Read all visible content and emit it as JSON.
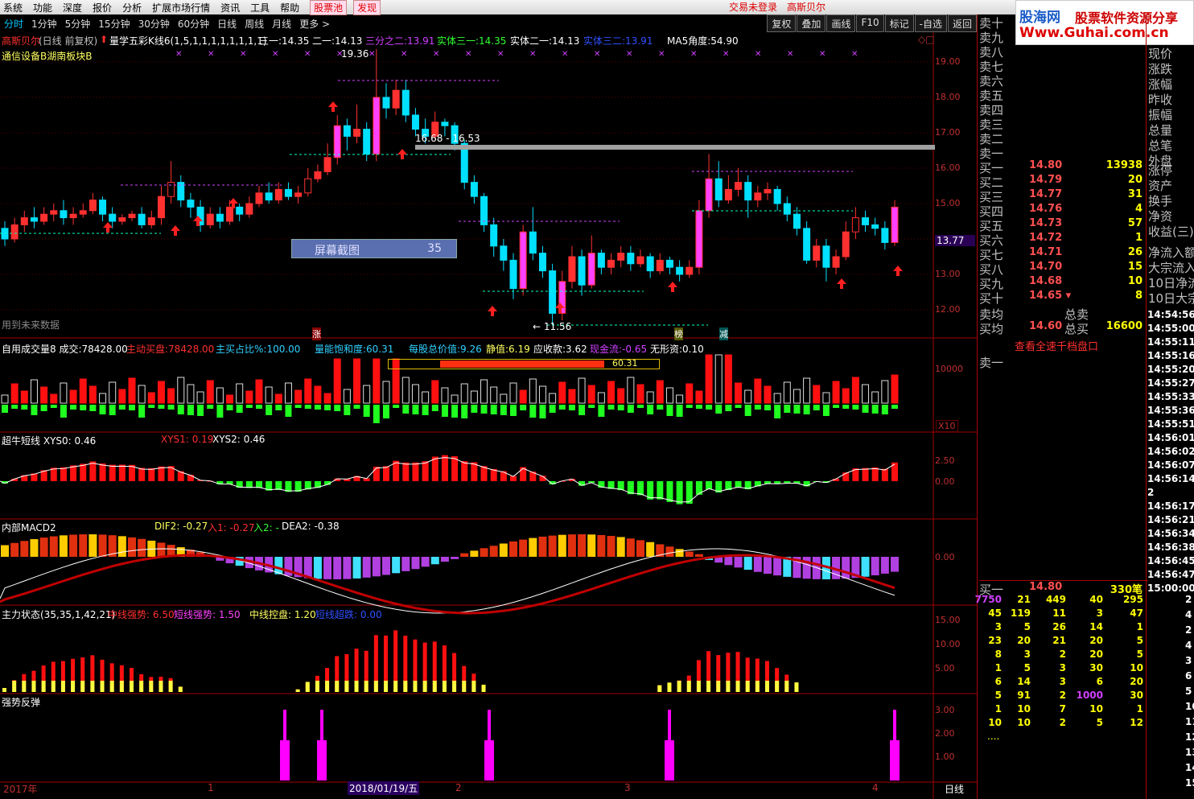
{
  "menubar": {
    "items": [
      "系统",
      "功能",
      "深度",
      "报价",
      "分析",
      "扩展市场行情",
      "资讯",
      "工具",
      "帮助"
    ],
    "pool": "股票池",
    "discover": "发现",
    "login_status": "交易未登录",
    "stock_name": "高斯贝尔"
  },
  "logo": {
    "brand": "股海网",
    "slogan": "股票软件资源分享",
    "url": "Www.Guhai.com.cn"
  },
  "periods": {
    "items": [
      "分时",
      "1分钟",
      "5分钟",
      "15分钟",
      "30分钟",
      "60分钟",
      "日线",
      "周线",
      "月线",
      "更多 >"
    ],
    "active": "分时"
  },
  "tools": [
    "复权",
    "叠加",
    "画线",
    "F10",
    "标记",
    "-自选",
    "返回"
  ],
  "main_panel": {
    "stock": "高斯贝尔",
    "mode": "(日线 前复权)",
    "indicator_name": "量学五彩K线6(1,5,1,1,1,1,1,1,1,1)",
    "v1_label": "三一:",
    "v1": "14.35",
    "v2_label": "二一:",
    "v2": "14.13",
    "v3_label": "三分之二:",
    "v3": "13.91",
    "v4_label": "实体三一:",
    "v4": "14.35",
    "v5_label": "实体二一:",
    "v5": "14.13",
    "v6_label": "实体三二:",
    "v6": "13.91",
    "v7_label": "MA5角度:",
    "v7": "54.90",
    "sector": "通信设备B湖南板块B",
    "future_note": "用到未来数据",
    "high_label": "19.36",
    "range_label": "16.68 - 16.53",
    "low_label": "← 11.56",
    "current_price": "13.77",
    "screenshot_label": "屏幕截图",
    "screenshot_num": "35",
    "marks": [
      "涨",
      "榜",
      "减"
    ],
    "price_axis": [
      "19.00",
      "18.00",
      "17.00",
      "16.00",
      "15.00",
      "14.00",
      "13.00",
      "12.00"
    ]
  },
  "vol_panel": {
    "title": "自用成交量8",
    "cj_label": "成交:",
    "cj": "78428.00",
    "zd_label": "主动买盘:",
    "zd": "78428.00",
    "zb_label": "主买占比%:",
    "zb": "100.00",
    "ln_label": "量能饱和度:",
    "ln": "60.31",
    "mg_label": "每股总价值:",
    "mg": "9.26",
    "jz_label": "静值:",
    "jz": "6.19",
    "ys_label": "应收款:",
    "ys": "3.62",
    "xj_label": "现金流:",
    "xj": "-0.65",
    "wx_label": "无形资:",
    "wx": "0.10",
    "bar_value": "60.31",
    "axis": [
      "10000"
    ],
    "unit": "X10"
  },
  "bull_panel": {
    "title": "超牛短线",
    "xys0_label": "XYS0:",
    "xys0": "0.46",
    "xys1_label": "XYS1:",
    "xys1": "0.19",
    "xys2_label": "XYS2:",
    "xys2": "0.46",
    "axis": [
      "2.50",
      "0.00"
    ]
  },
  "macd_panel": {
    "title": "内部MACD2",
    "dif_label": "DIF2:",
    "dif": "-0.27",
    "r1_label": "入1:",
    "r1": "-0.27",
    "r2_label": "入2:",
    "r2": "-",
    "dea_label": "DEA2:",
    "dea": "-0.38",
    "axis": [
      "0.00"
    ]
  },
  "force_panel": {
    "title": "主力状态(35,35,1,42,21)",
    "z_label": "中线强势:",
    "z": "6.50",
    "d_label": "短线强势:",
    "d": "1.50",
    "k_label": "中线控盘:",
    "k": "1.20",
    "c_label": "短线超跌:",
    "c": "0.00",
    "axis": [
      "15.00",
      "10.00",
      "5.00"
    ]
  },
  "rebound_panel": {
    "title": "强势反弹",
    "axis": [
      "3.00",
      "2.00",
      "1.00"
    ]
  },
  "date_bar": {
    "year": "2017年",
    "m1": "1",
    "date": "2018/01/19/五",
    "m2": "2",
    "m3": "3",
    "m4": "4",
    "period": "日线"
  },
  "chart_data": {
    "type": "candlestick",
    "price_range": [
      11.5,
      19.6
    ],
    "candles": [
      [
        14.3,
        14.0,
        14.5,
        13.8
      ],
      [
        14.0,
        14.4,
        14.6,
        13.9
      ],
      [
        14.4,
        14.6,
        14.8,
        14.2
      ],
      [
        14.6,
        14.5,
        14.9,
        14.3
      ],
      [
        14.5,
        14.7,
        14.9,
        14.4
      ],
      [
        14.7,
        14.8,
        15.0,
        14.5
      ],
      [
        14.8,
        14.6,
        15.1,
        14.4
      ],
      [
        14.6,
        14.7,
        14.9,
        14.4
      ],
      [
        14.7,
        14.8,
        15.0,
        14.6
      ],
      [
        14.8,
        15.1,
        15.3,
        14.7
      ],
      [
        15.1,
        14.7,
        15.2,
        14.5
      ],
      [
        14.7,
        14.5,
        14.9,
        14.3
      ],
      [
        14.5,
        14.6,
        14.7,
        14.4
      ],
      [
        14.6,
        14.7,
        14.8,
        14.5
      ],
      [
        14.7,
        14.4,
        14.9,
        14.3
      ],
      [
        14.4,
        14.6,
        14.8,
        14.3
      ],
      [
        14.6,
        15.2,
        15.5,
        14.4
      ],
      [
        15.2,
        15.6,
        16.2,
        15.0
      ],
      [
        15.6,
        15.1,
        15.8,
        14.9
      ],
      [
        15.1,
        14.9,
        15.3,
        14.6
      ],
      [
        14.9,
        14.4,
        15.1,
        14.2
      ],
      [
        14.4,
        14.7,
        14.9,
        14.3
      ],
      [
        14.7,
        14.5,
        14.9,
        14.3
      ],
      [
        14.5,
        14.9,
        15.1,
        14.4
      ],
      [
        14.9,
        14.7,
        15.0,
        14.5
      ],
      [
        14.7,
        15.0,
        15.2,
        14.6
      ],
      [
        15.0,
        15.3,
        15.5,
        14.9
      ],
      [
        15.3,
        15.1,
        15.6,
        15.0
      ],
      [
        15.1,
        15.4,
        15.6,
        15.0
      ],
      [
        15.4,
        15.2,
        15.6,
        15.1
      ],
      [
        15.2,
        15.3,
        15.5,
        15.0
      ],
      [
        15.3,
        15.7,
        16.0,
        15.2
      ],
      [
        15.7,
        15.9,
        16.1,
        15.6
      ],
      [
        15.9,
        16.3,
        16.7,
        15.8
      ],
      [
        16.3,
        17.2,
        17.5,
        16.1
      ],
      [
        17.2,
        16.9,
        17.4,
        16.5
      ],
      [
        16.9,
        17.1,
        17.8,
        16.7
      ],
      [
        17.1,
        16.4,
        17.3,
        16.2
      ],
      [
        16.4,
        18.0,
        19.36,
        16.2
      ],
      [
        18.0,
        17.7,
        18.4,
        17.4
      ],
      [
        17.7,
        18.2,
        18.5,
        17.5
      ],
      [
        18.2,
        17.5,
        18.5,
        17.3
      ],
      [
        17.5,
        17.1,
        17.7,
        16.9
      ],
      [
        17.1,
        16.9,
        17.4,
        16.7
      ],
      [
        16.9,
        17.3,
        17.6,
        16.8
      ],
      [
        17.3,
        17.2,
        17.4,
        16.9
      ],
      [
        17.2,
        16.7,
        17.3,
        16.5
      ],
      [
        16.7,
        15.6,
        16.8,
        15.4
      ],
      [
        15.6,
        15.2,
        15.8,
        15.0
      ],
      [
        15.2,
        14.4,
        15.3,
        14.2
      ],
      [
        14.4,
        13.8,
        14.6,
        13.5
      ],
      [
        13.8,
        13.4,
        14.0,
        13.1
      ],
      [
        13.4,
        12.6,
        13.6,
        12.3
      ],
      [
        12.6,
        14.2,
        14.4,
        12.4
      ],
      [
        14.2,
        13.6,
        14.9,
        13.4
      ],
      [
        13.6,
        13.1,
        13.8,
        12.9
      ],
      [
        13.1,
        11.9,
        13.3,
        11.56
      ],
      [
        11.9,
        12.8,
        13.1,
        11.7
      ],
      [
        12.8,
        13.5,
        13.8,
        12.6
      ],
      [
        13.5,
        12.7,
        13.7,
        12.4
      ],
      [
        12.7,
        13.6,
        14.1,
        12.6
      ],
      [
        13.6,
        13.2,
        13.7,
        13.0
      ],
      [
        13.2,
        13.4,
        13.6,
        13.0
      ],
      [
        13.4,
        13.6,
        13.8,
        13.2
      ],
      [
        13.6,
        13.3,
        13.8,
        13.1
      ],
      [
        13.3,
        13.5,
        13.7,
        13.2
      ],
      [
        13.5,
        13.1,
        13.6,
        12.9
      ],
      [
        13.1,
        13.4,
        13.6,
        13.0
      ],
      [
        13.4,
        13.2,
        13.5,
        13.0
      ],
      [
        13.2,
        13.0,
        13.4,
        12.8
      ],
      [
        13.0,
        13.2,
        13.4,
        12.9
      ],
      [
        13.2,
        14.8,
        15.1,
        13.0
      ],
      [
        14.8,
        15.7,
        16.4,
        14.6
      ],
      [
        15.7,
        15.1,
        16.2,
        14.9
      ],
      [
        15.1,
        15.4,
        15.8,
        15.0
      ],
      [
        15.4,
        15.6,
        16.0,
        15.2
      ],
      [
        15.6,
        15.1,
        15.8,
        14.6
      ],
      [
        15.1,
        15.3,
        15.5,
        14.9
      ],
      [
        15.3,
        15.4,
        15.6,
        15.1
      ],
      [
        15.4,
        15.0,
        15.5,
        14.8
      ],
      [
        15.0,
        14.7,
        15.2,
        14.5
      ],
      [
        14.7,
        14.3,
        14.9,
        14.1
      ],
      [
        14.3,
        13.4,
        14.5,
        13.3
      ],
      [
        13.4,
        13.8,
        14.0,
        13.2
      ],
      [
        13.8,
        13.2,
        14.0,
        12.8
      ],
      [
        13.2,
        13.5,
        13.7,
        13.0
      ],
      [
        13.5,
        14.2,
        14.5,
        13.4
      ],
      [
        14.2,
        14.6,
        14.9,
        14.0
      ],
      [
        14.6,
        14.4,
        14.8,
        14.2
      ],
      [
        14.4,
        14.3,
        14.6,
        14.1
      ],
      [
        14.3,
        13.9,
        14.5,
        13.7
      ],
      [
        13.9,
        14.9,
        15.1,
        13.8
      ]
    ]
  },
  "orderbook": {
    "sells": [
      {
        "label": "卖十"
      },
      {
        "label": "卖九"
      },
      {
        "label": "卖八"
      },
      {
        "label": "卖七"
      },
      {
        "label": "卖六"
      },
      {
        "label": "卖五"
      },
      {
        "label": "卖四"
      },
      {
        "label": "卖三"
      },
      {
        "label": "卖二"
      },
      {
        "label": "卖一"
      }
    ],
    "buys": [
      {
        "label": "买一",
        "price": "14.80",
        "vol": "13938"
      },
      {
        "label": "买二",
        "price": "14.79",
        "vol": "20"
      },
      {
        "label": "买三",
        "price": "14.77",
        "vol": "31"
      },
      {
        "label": "买四",
        "price": "14.76",
        "vol": "4"
      },
      {
        "label": "买五",
        "price": "14.73",
        "vol": "57"
      },
      {
        "label": "买六",
        "price": "14.72",
        "vol": "1"
      },
      {
        "label": "买七",
        "price": "14.71",
        "vol": "26"
      },
      {
        "label": "买八",
        "price": "14.70",
        "vol": "15"
      },
      {
        "label": "买九",
        "price": "14.68",
        "vol": "10"
      },
      {
        "label": "买十",
        "price": "14.65 ▾",
        "vol": "8"
      }
    ],
    "sell_avg": "卖均",
    "total_sell": "总卖",
    "buy_avg": "买均",
    "buy_avg_price": "14.60",
    "total_buy": "总买",
    "total_buy_val": "16600",
    "view_full": "查看全速千档盘口",
    "sell1": "卖一",
    "buy1_label": "买一",
    "buy1_price": "14.80",
    "buy1_count": "330笔",
    "queue": [
      [
        "7750",
        "21",
        "449",
        "40",
        "295"
      ],
      [
        "45",
        "119",
        "11",
        "3",
        "47"
      ],
      [
        "3",
        "5",
        "26",
        "14",
        "1"
      ],
      [
        "23",
        "20",
        "21",
        "20",
        "5"
      ],
      [
        "8",
        "3",
        "2",
        "20",
        "5"
      ],
      [
        "1",
        "5",
        "3",
        "30",
        "10"
      ],
      [
        "6",
        "14",
        "3",
        "6",
        "20"
      ],
      [
        "5",
        "91",
        "2",
        "1000",
        "30"
      ],
      [
        "1",
        "10",
        "7",
        "10",
        "1"
      ],
      [
        "10",
        "10",
        "2",
        "5",
        "12"
      ]
    ],
    "more": "...."
  },
  "fields": [
    "现价",
    "涨跌",
    "涨幅",
    "昨收",
    "振幅",
    "总量",
    "总笔",
    "外盘",
    "涨停",
    "资产",
    "换手",
    "净资",
    "收益(三)",
    "净流入额",
    "大宗流入",
    "10日净流",
    "10日大宗"
  ],
  "ticks": [
    "14:54:56",
    "14:55:00",
    "14:55:11",
    "14:55:16",
    "14:55:20",
    "14:55:27",
    "14:55:33",
    "14:55:36",
    "14:55:51",
    "14:56:01",
    "14:56:02",
    "14:56:07",
    "14:56:14",
    "2",
    "14:56:17",
    "14:56:21",
    "14:56:34",
    "14:56:38",
    "14:56:45",
    "14:56:47",
    "15:00:00"
  ],
  "far_right_numbers": [
    "2",
    "4",
    "2",
    "4",
    "3",
    "6",
    "5",
    "10",
    "11",
    "12",
    "13",
    "14",
    "15"
  ],
  "colors": {
    "up": "#ff3030",
    "down": "#00e0ff",
    "bg": "#000000",
    "grid": "#7a0000",
    "magenta": "#ff00ff",
    "yellow": "#ffff00",
    "green": "#00ff00"
  }
}
